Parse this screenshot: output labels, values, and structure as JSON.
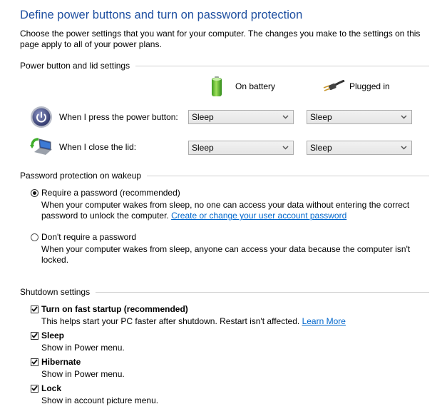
{
  "page": {
    "title": "Define power buttons and turn on password protection",
    "intro": "Choose the power settings that you want for your computer. The changes you make to the settings on this page apply to all of your power plans."
  },
  "power_section": {
    "header": "Power button and lid settings",
    "columns": [
      {
        "label": "On battery",
        "icon": "battery-icon"
      },
      {
        "label": "Plugged in",
        "icon": "power-plug-icon"
      }
    ],
    "rows": [
      {
        "label": "When I press the power button:",
        "icon": "power-button-icon",
        "on_battery": "Sleep",
        "plugged_in": "Sleep"
      },
      {
        "label": "When I close the lid:",
        "icon": "laptop-lid-icon",
        "on_battery": "Sleep",
        "plugged_in": "Sleep"
      }
    ]
  },
  "password_section": {
    "header": "Password protection on wakeup",
    "options": [
      {
        "label": "Require a password (recommended)",
        "selected": true,
        "description": "When your computer wakes from sleep, no one can access your data without entering the correct",
        "description2": "password to unlock the computer.",
        "link": "Create or change your user account password"
      },
      {
        "label": "Don't require a password",
        "selected": false,
        "description": "When your computer wakes from sleep, anyone can access your data because the computer isn't",
        "description2": "locked."
      }
    ]
  },
  "shutdown_section": {
    "header": "Shutdown settings",
    "items": [
      {
        "label": "Turn on fast startup (recommended)",
        "checked": true,
        "description": "This helps start your PC faster after shutdown. Restart isn't affected.",
        "link": "Learn More"
      },
      {
        "label": "Sleep",
        "checked": true,
        "description": "Show in Power menu."
      },
      {
        "label": "Hibernate",
        "checked": true,
        "description": "Show in Power menu."
      },
      {
        "label": "Lock",
        "checked": true,
        "description": "Show in account picture menu."
      }
    ]
  },
  "colors": {
    "title": "#1e4fa0",
    "link": "#0066cc"
  }
}
